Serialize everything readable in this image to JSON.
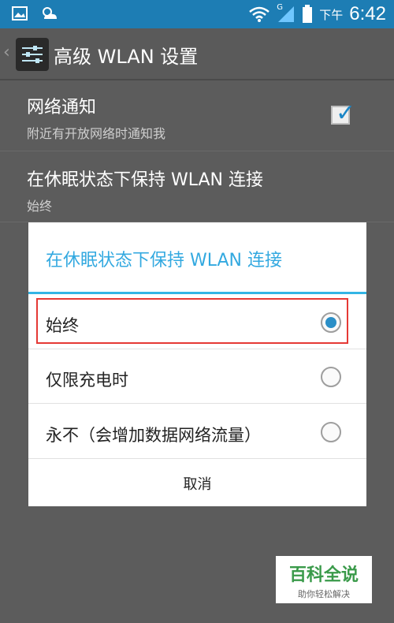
{
  "status_bar": {
    "period": "下午",
    "time": "6:42",
    "network_badge": "G",
    "icons": [
      "gallery-icon",
      "weather-icon",
      "wifi-icon",
      "signal-icon",
      "battery-icon"
    ]
  },
  "action_bar": {
    "title": "高级 WLAN 设置",
    "icon": "settings-sliders-icon"
  },
  "settings": {
    "network_notify": {
      "title": "网络通知",
      "subtitle": "附近有开放网络时通知我",
      "checked": true
    },
    "sleep_policy": {
      "title": "在休眠状态下保持 WLAN 连接",
      "subtitle": "始终"
    }
  },
  "dialog": {
    "title": "在休眠状态下保持 WLAN 连接",
    "options": [
      {
        "label": "始终",
        "selected": true
      },
      {
        "label": "仅限充电时",
        "selected": false
      },
      {
        "label": "永不（会增加数据网络流量）",
        "selected": false
      }
    ],
    "cancel_label": "取消"
  },
  "watermark": {
    "title": "百科全说",
    "subtitle": "助你轻松解决"
  },
  "colors": {
    "status_bar": "#1d7db4",
    "dialog_accent": "#33b5e5",
    "highlight_border": "#e53935"
  }
}
